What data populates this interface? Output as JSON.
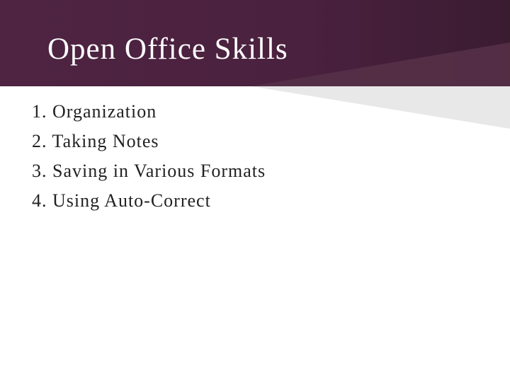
{
  "title": "Open Office Skills",
  "items": [
    {
      "number": "1.",
      "text": "Organization"
    },
    {
      "number": "2.",
      "text": "Taking Notes"
    },
    {
      "number": "3.",
      "text": "Saving in Various Formats"
    },
    {
      "number": "4.",
      "text": "Using Auto-Correct"
    }
  ],
  "colors": {
    "header": "#4e2442",
    "accent_triangle": "#563048",
    "gray_triangle": "#e8e8e8"
  }
}
